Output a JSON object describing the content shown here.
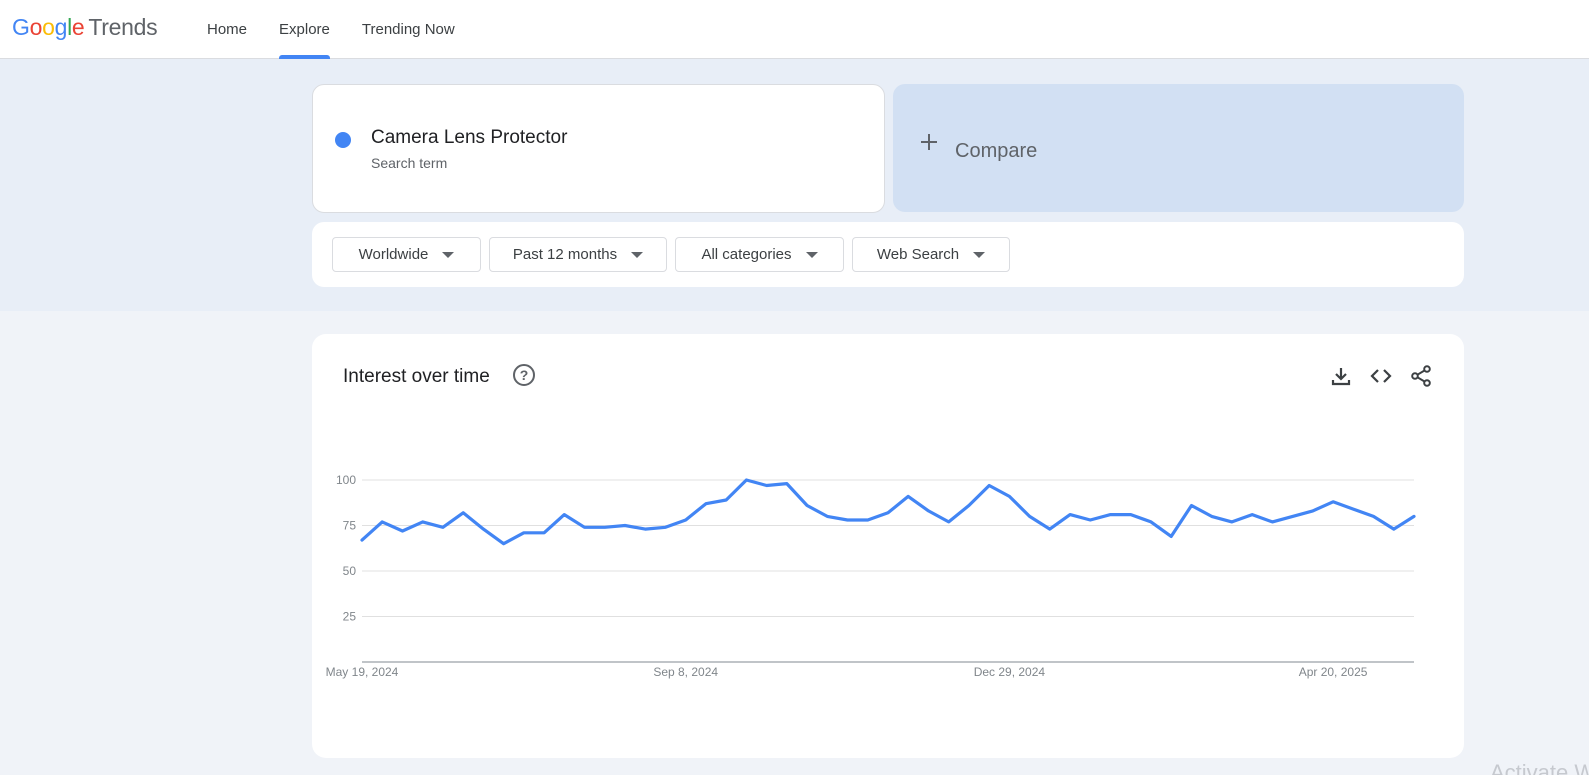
{
  "header": {
    "logo_letters": [
      {
        "char": "G",
        "color": "#4285f4"
      },
      {
        "char": "o",
        "color": "#ea4335"
      },
      {
        "char": "o",
        "color": "#fbbc05"
      },
      {
        "char": "g",
        "color": "#4285f4"
      },
      {
        "char": "l",
        "color": "#34a853"
      },
      {
        "char": "e",
        "color": "#ea4335"
      }
    ],
    "logo_suffix": "Trends",
    "nav": [
      {
        "label": "Home",
        "active": false
      },
      {
        "label": "Explore",
        "active": true
      },
      {
        "label": "Trending Now",
        "active": false
      }
    ]
  },
  "search": {
    "term": "Camera Lens Protector",
    "term_type": "Search term",
    "term_color": "#4285f4",
    "compare_label": "Compare"
  },
  "filters": [
    {
      "label": "Worldwide"
    },
    {
      "label": "Past 12 months"
    },
    {
      "label": "All categories"
    },
    {
      "label": "Web Search"
    }
  ],
  "chart": {
    "title": "Interest over time",
    "icons": [
      "download-icon",
      "embed-code-icon",
      "share-icon"
    ]
  },
  "chart_data": {
    "type": "line",
    "title": "Interest over time",
    "xlabel": "",
    "ylabel": "",
    "ylim": [
      0,
      100
    ],
    "yticks": [
      25,
      50,
      75,
      100
    ],
    "grid": true,
    "x_tick_labels": [
      "May 19, 2024",
      "Sep 8, 2024",
      "Dec 29, 2024",
      "Apr 20, 2025"
    ],
    "x_tick_indices": [
      0,
      16,
      32,
      48
    ],
    "series": [
      {
        "name": "Camera Lens Protector",
        "color": "#4285f4",
        "values": [
          67,
          77,
          72,
          77,
          74,
          82,
          73,
          65,
          71,
          71,
          81,
          74,
          74,
          75,
          73,
          74,
          78,
          87,
          89,
          100,
          97,
          98,
          86,
          80,
          78,
          78,
          82,
          91,
          83,
          77,
          86,
          97,
          91,
          80,
          73,
          81,
          78,
          81,
          81,
          77,
          69,
          86,
          80,
          77,
          81,
          77,
          80,
          83,
          88,
          84,
          80,
          73,
          80
        ]
      }
    ]
  },
  "watermark": "Activate W"
}
